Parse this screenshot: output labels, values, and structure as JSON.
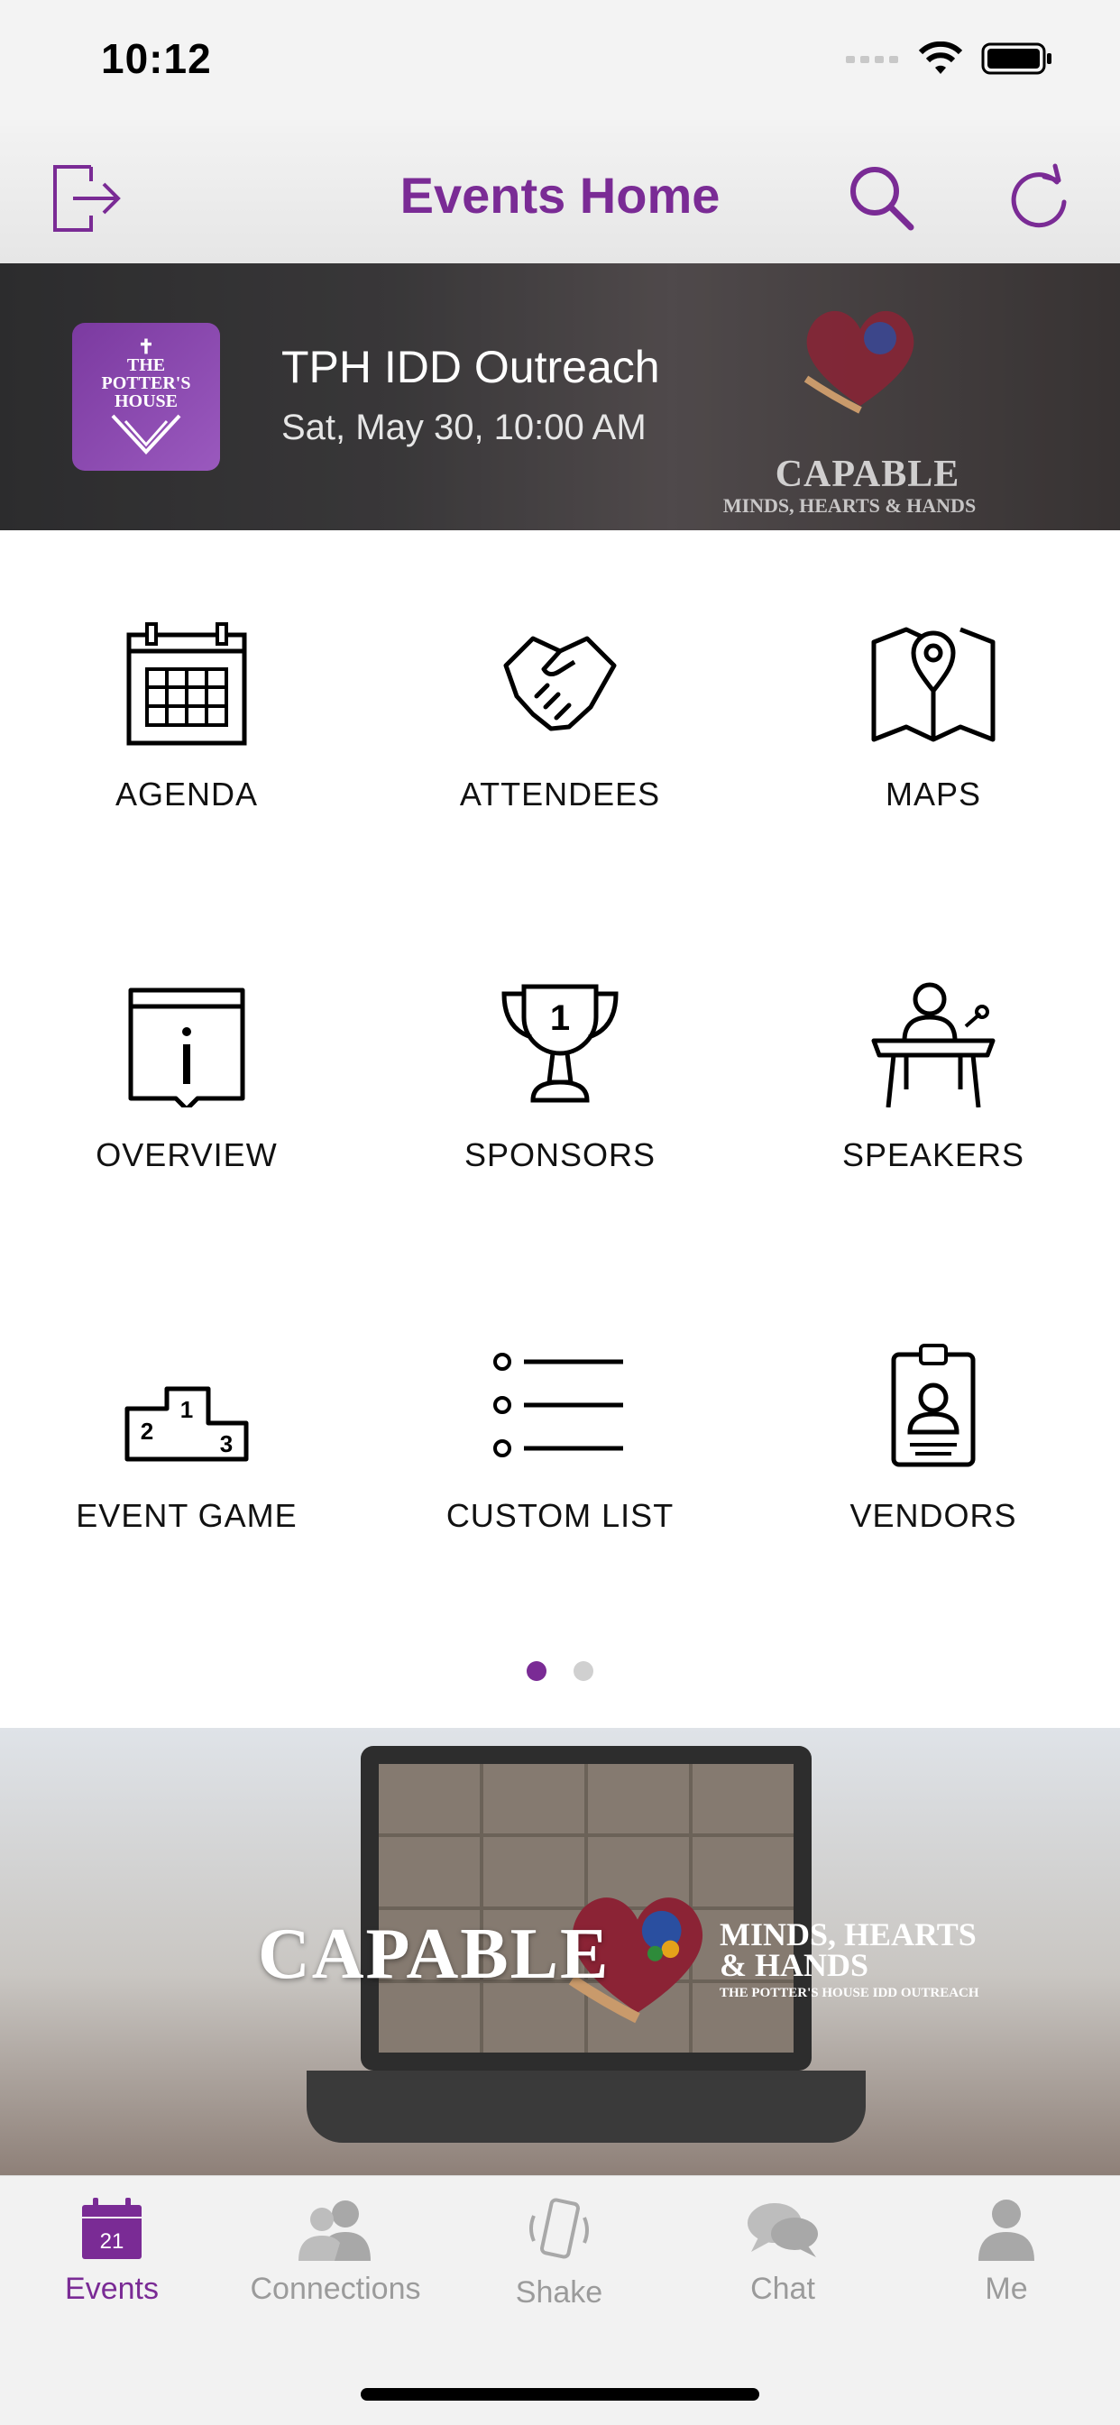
{
  "status_bar": {
    "time": "10:12"
  },
  "nav": {
    "title": "Events Home",
    "left_icon": "logout-icon",
    "search_icon": "search-icon",
    "refresh_icon": "refresh-icon"
  },
  "event": {
    "name": "TPH IDD Outreach",
    "date": "Sat, May 30, 10:00 AM",
    "logo_lines": [
      "THE",
      "POTTER'S",
      "HOUSE"
    ],
    "brand_word": "CAPABLE",
    "brand_sub": "MINDS, HEARTS & HANDS"
  },
  "tiles": [
    {
      "label": "AGENDA",
      "icon": "calendar-icon"
    },
    {
      "label": "ATTENDEES",
      "icon": "handshake-icon"
    },
    {
      "label": "MAPS",
      "icon": "map-icon"
    },
    {
      "label": "OVERVIEW",
      "icon": "info-icon"
    },
    {
      "label": "SPONSORS",
      "icon": "trophy-icon"
    },
    {
      "label": "SPEAKERS",
      "icon": "podium-speaker-icon"
    },
    {
      "label": "EVENT GAME",
      "icon": "podium-ranking-icon"
    },
    {
      "label": "CUSTOM LIST",
      "icon": "list-icon"
    },
    {
      "label": "VENDORS",
      "icon": "badge-icon"
    }
  ],
  "pager": {
    "pages": 2,
    "current": 1
  },
  "promo": {
    "word": "CAPABLE",
    "tag1": "MINDS, HEARTS",
    "tag1b": "& HANDS",
    "tag2": "THE POTTER'S HOUSE IDD OUTREACH"
  },
  "tabs": [
    {
      "label": "Events",
      "icon": "calendar-icon",
      "badge": "21",
      "active": true
    },
    {
      "label": "Connections",
      "icon": "people-icon",
      "active": false
    },
    {
      "label": "Shake",
      "icon": "phone-shake-icon",
      "active": false
    },
    {
      "label": "Chat",
      "icon": "chat-bubbles-icon",
      "active": false
    },
    {
      "label": "Me",
      "icon": "person-icon",
      "active": false
    }
  ],
  "colors": {
    "accent": "#7a2b95",
    "inactive": "#9b9b9b"
  }
}
